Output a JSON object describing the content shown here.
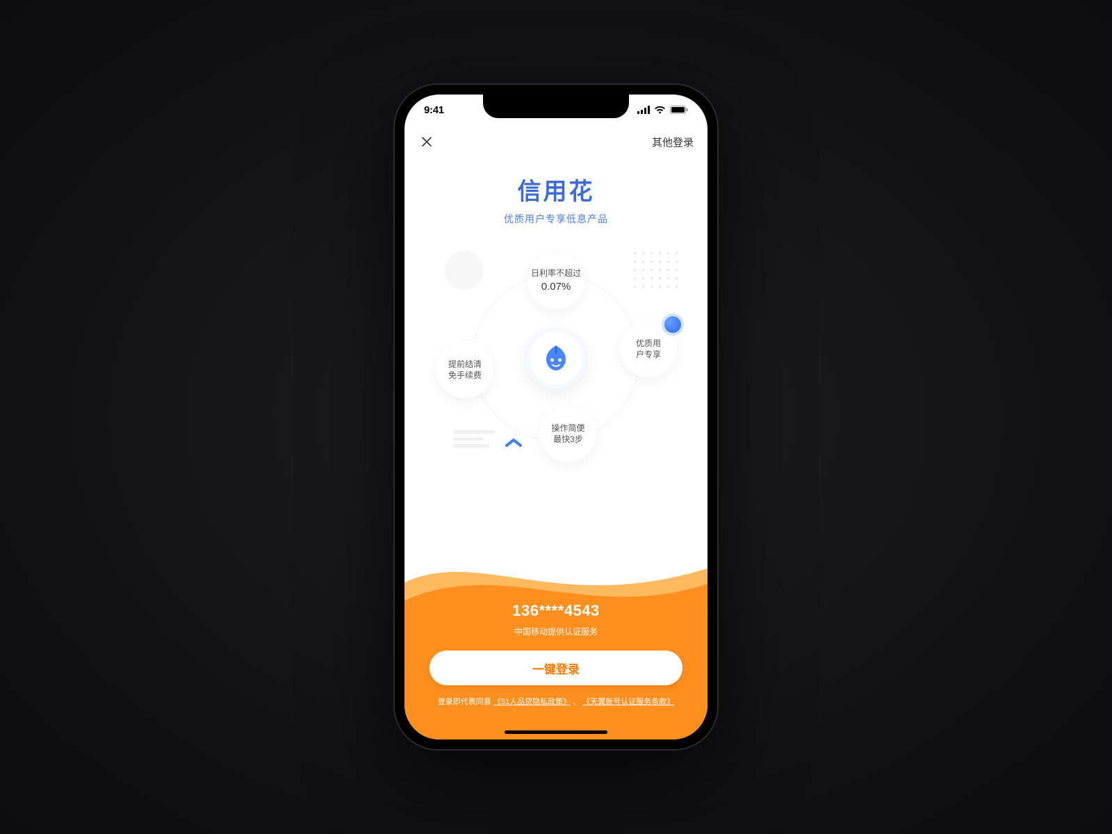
{
  "status_bar": {
    "time": "9:41"
  },
  "nav": {
    "other_login": "其他登录"
  },
  "brand": {
    "title": "信用花",
    "subtitle": "优质用户专享低息产品"
  },
  "features": {
    "top": {
      "line1": "日利率不超过",
      "line2": "0.07%"
    },
    "right": {
      "line1": "优质用",
      "line2": "户专享"
    },
    "bottom": {
      "line1": "操作简便",
      "line2": "最快3步"
    },
    "left": {
      "line1": "提前结清",
      "line2": "免手续费"
    }
  },
  "login": {
    "phone": "136****4543",
    "provider": "中国移动提供认证服务",
    "button": "一键登录"
  },
  "terms": {
    "prefix": "登录即代表同意",
    "link1": "《51人品贷隐私政策》",
    "separator": "、",
    "link2": "《天翼账号认证服务条款》"
  },
  "colors": {
    "accent_orange": "#ff8f1f",
    "accent_orange_light": "#ffb95e",
    "brand_blue": "#3b6bd6"
  }
}
